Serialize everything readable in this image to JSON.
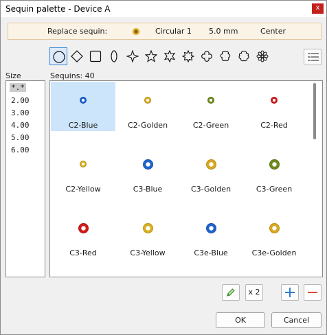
{
  "window": {
    "title": "Sequin palette - Device A",
    "close_label": "x"
  },
  "replace": {
    "label": "Replace sequin:",
    "shape": "Circular 1",
    "size": "5.0 mm",
    "position": "Center",
    "color": "#d9a820"
  },
  "shapes": [
    "circle",
    "diamond",
    "square",
    "ellipse",
    "star-4",
    "star-5",
    "star-6",
    "star-8",
    "clover-4",
    "flower-5",
    "flower-6",
    "flower-8"
  ],
  "selected_shape": "circle",
  "size_panel": {
    "label": "Size",
    "items": [
      "*.*",
      "2.00",
      "3.00",
      "4.00",
      "5.00",
      "6.00"
    ],
    "selected": "*.*"
  },
  "sequins": {
    "label": "Sequins: 40",
    "items": [
      {
        "name": "C2-Blue",
        "color": "#1e64d0",
        "selected": true
      },
      {
        "name": "C2-Golden",
        "color": "#d9a820"
      },
      {
        "name": "C2-Green",
        "color": "#6f8a1e"
      },
      {
        "name": "C2-Red",
        "color": "#d21c1c"
      },
      {
        "name": "C2-Yellow",
        "color": "#d9b020"
      },
      {
        "name": "C3-Blue",
        "color": "#1e64d0"
      },
      {
        "name": "C3-Golden",
        "color": "#d9a820"
      },
      {
        "name": "C3-Green",
        "color": "#6f8a1e"
      },
      {
        "name": "C3-Red",
        "color": "#d21c1c"
      },
      {
        "name": "C3-Yellow",
        "color": "#d9b020"
      },
      {
        "name": "C3e-Blue",
        "color": "#1e64d0"
      },
      {
        "name": "C3e-Golden",
        "color": "#d9a820"
      }
    ]
  },
  "toolbar": {
    "multiply_label": "x 2"
  },
  "dialog": {
    "ok_label": "OK",
    "cancel_label": "Cancel"
  },
  "colors": {
    "accent": "#3a86d6",
    "selection": "#cde5fb",
    "delete": "#d84a3a",
    "add": "#2f7bd1"
  }
}
